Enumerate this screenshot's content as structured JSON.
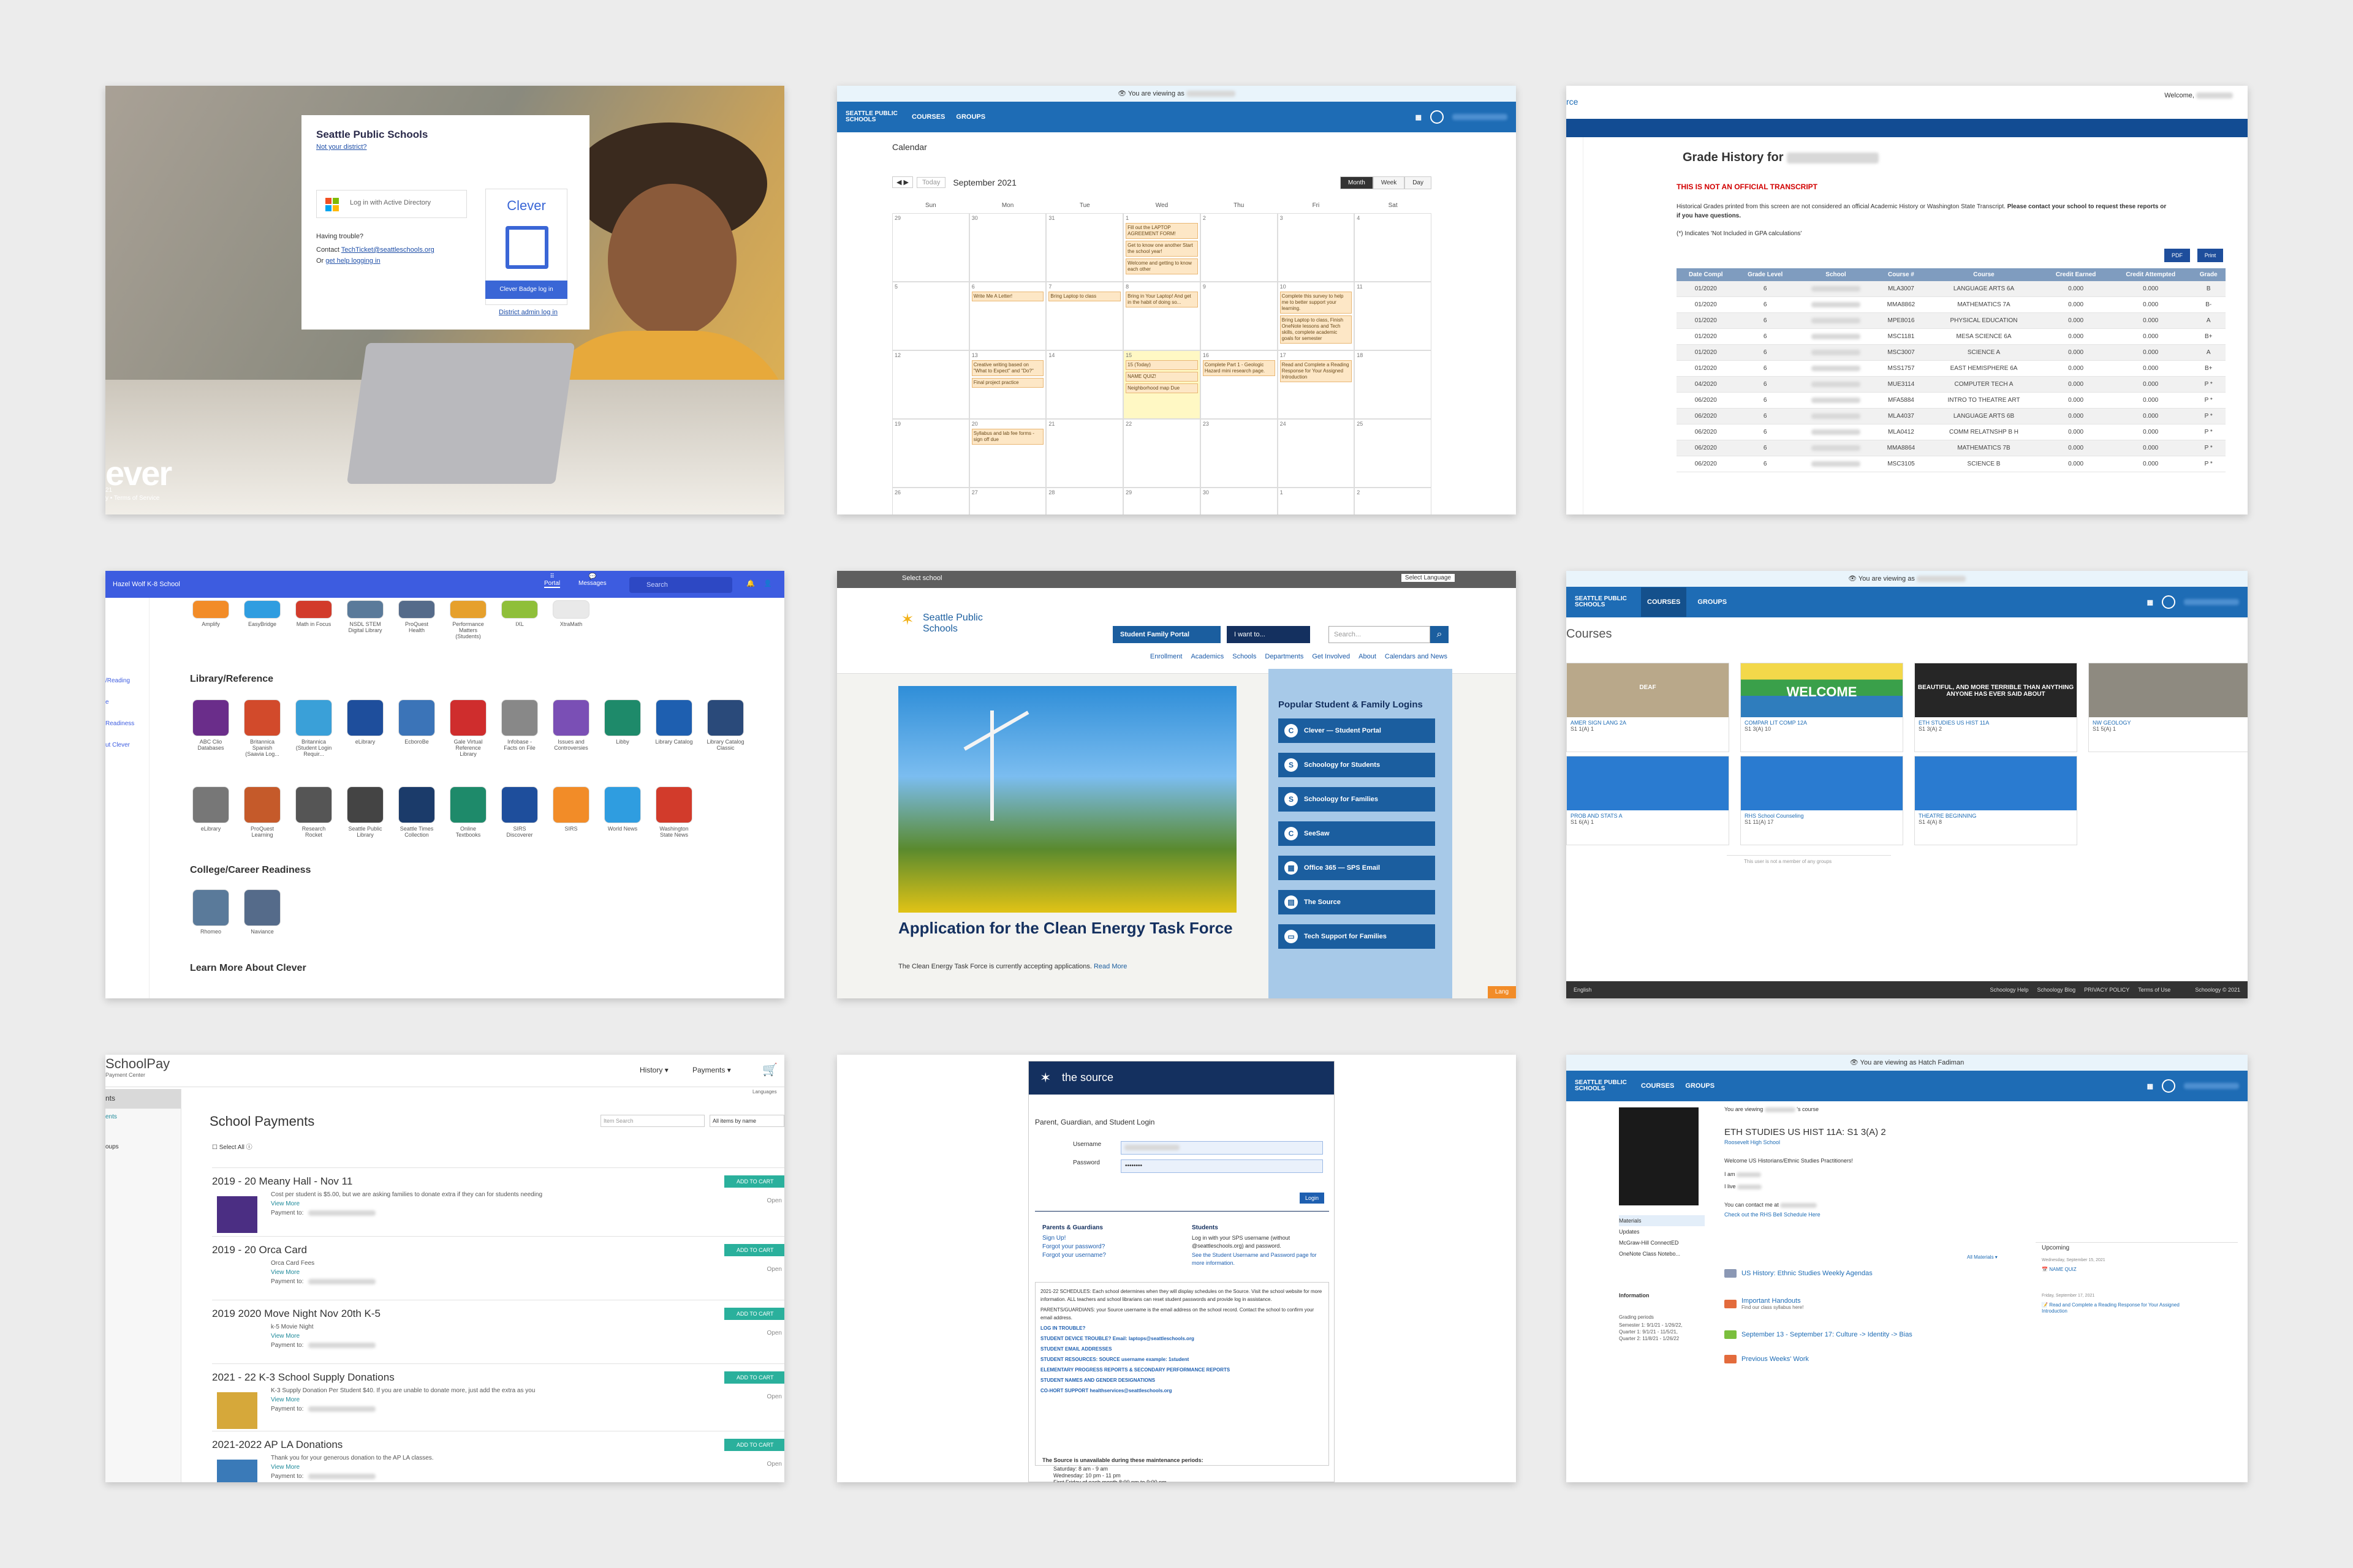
{
  "panel1": {
    "district": "Seattle Public Schools",
    "not_district": "Not your district?",
    "ad_login": "Log in with Active Directory",
    "having_trouble": "Having trouble?",
    "contact_prefix": "Contact",
    "contact_email": "TechTicket@seattleschools.org",
    "get_help_prefix": "Or",
    "get_help": "get help logging in",
    "clever_logo": "Clever",
    "badge_button": "Clever Badge log in",
    "district_admin": "District admin log in",
    "brand_text": "ever",
    "footer_year": "21",
    "footer_terms": "y • Terms of Service"
  },
  "panel2": {
    "viewing_as": "You are viewing as",
    "logo": "SEATTLE PUBLIC SCHOOLS",
    "nav": [
      "COURSES",
      "GROUPS"
    ],
    "title": "Calendar",
    "today": "Today",
    "month": "September 2021",
    "views": [
      "Month",
      "Week",
      "Day"
    ],
    "days": [
      "Sun",
      "Mon",
      "Tue",
      "Wed",
      "Thu",
      "Fri",
      "Sat"
    ],
    "weeks": [
      [
        "29",
        "30",
        "31",
        "1",
        "2",
        "3",
        "4"
      ],
      [
        "5",
        "6",
        "7",
        "8",
        "9",
        "10",
        "11"
      ],
      [
        "12",
        "13",
        "14",
        "15",
        "16",
        "17",
        "18"
      ],
      [
        "19",
        "20",
        "21",
        "22",
        "23",
        "24",
        "25"
      ],
      [
        "26",
        "27",
        "28",
        "29",
        "30",
        "1",
        "2"
      ]
    ],
    "events": {
      "e1": "Fill out the LAPTOP AGREEMENT FORM!",
      "e2": "Get to know one another Start the school year!",
      "e3": "Welcome and getting to know each other",
      "e4": "Write Me A Letter!",
      "e5": "Bring Laptop to class",
      "e6": "Bring in Your Laptop! And get in the habit of doing so...",
      "e7": "Complete this survey to help me to better support your learning.",
      "e8": "Bring Laptop to class, Finish OneNote lessons and Tech skills, complete academic goals for semester",
      "e9": "Creative writing based on \"What to Expect\" and \"Do?\"",
      "e10": "Final project practice",
      "e11": "NAME QUIZ!",
      "e12": "Neighborhood map Due",
      "e13": "Complete Part 1 - Geologic Hazard mini research page.",
      "e14": "Read and Complete a Reading Response for Your Assigned Introduction",
      "e15": "Syllabus and lab fee forms - sign off due",
      "e16": "15 (Today)"
    }
  },
  "panel3": {
    "left_text": "rce",
    "welcome": "Welcome,",
    "title": "Grade History for",
    "warning": "THIS IS NOT AN OFFICIAL TRANSCRIPT",
    "note1": "Historical Grades printed from this screen are not considered an official Academic History or Washington State Transcript.",
    "note1b": "Please contact your school to request these reports or if you have questions.",
    "note2": "(*) Indicates 'Not Included in GPA calculations'",
    "pdf": "PDF",
    "print": "Print",
    "headers": [
      "Date Compl",
      "Grade Level",
      "School",
      "Course #",
      "Course",
      "Credit Earned",
      "Credit Attempted",
      "Grade"
    ],
    "rows": [
      [
        "01/2020",
        "6",
        "",
        "MLA3007",
        "LANGUAGE ARTS 6A",
        "0.000",
        "0.000",
        "B"
      ],
      [
        "01/2020",
        "6",
        "",
        "MMA8862",
        "MATHEMATICS 7A",
        "0.000",
        "0.000",
        "B-"
      ],
      [
        "01/2020",
        "6",
        "",
        "MPE8016",
        "PHYSICAL EDUCATION",
        "0.000",
        "0.000",
        "A"
      ],
      [
        "01/2020",
        "6",
        "",
        "MSC1181",
        "MESA SCIENCE 6A",
        "0.000",
        "0.000",
        "B+"
      ],
      [
        "01/2020",
        "6",
        "",
        "MSC3007",
        "SCIENCE A",
        "0.000",
        "0.000",
        "A"
      ],
      [
        "01/2020",
        "6",
        "",
        "MSS1757",
        "EAST HEMISPHERE 6A",
        "0.000",
        "0.000",
        "B+"
      ],
      [
        "04/2020",
        "6",
        "",
        "MUE3114",
        "COMPUTER TECH A",
        "0.000",
        "0.000",
        "P *"
      ],
      [
        "06/2020",
        "6",
        "",
        "MFA5884",
        "INTRO TO THEATRE ART",
        "0.000",
        "0.000",
        "P *"
      ],
      [
        "06/2020",
        "6",
        "",
        "MLA4037",
        "LANGUAGE ARTS 6B",
        "0.000",
        "0.000",
        "P *"
      ],
      [
        "06/2020",
        "6",
        "",
        "MLA0412",
        "COMM RELATNSHP B H",
        "0.000",
        "0.000",
        "P *"
      ],
      [
        "06/2020",
        "6",
        "",
        "MMA8864",
        "MATHEMATICS 7B",
        "0.000",
        "0.000",
        "P *"
      ],
      [
        "06/2020",
        "6",
        "",
        "MSC3105",
        "SCIENCE B",
        "0.000",
        "0.000",
        "P *"
      ]
    ]
  },
  "panel4": {
    "school": "Hazel Wolf K-8 School",
    "portal": "Portal",
    "messages": "Messages",
    "search_placeholder": "Search",
    "side_links": [
      "/Reading",
      "e",
      "Readiness",
      "ut Clever"
    ],
    "row1": [
      "Amplify",
      "EasyBridge",
      "Math in Focus",
      "NSDL STEM Digital Library",
      "ProQuest Health",
      "Performance Matters (Students)",
      "IXL",
      "XtraMath"
    ],
    "section1": "Library/Reference",
    "row2": [
      "ABC Clio Databases",
      "Britannica Spanish (Saavia Log...",
      "Britannica (Student Login Requir...",
      "eLibrary",
      "EcboroBe",
      "Gale Virtual Reference Library",
      "Infobase - Facts on File",
      "Issues and Controversies",
      "Libby",
      "Library Catalog",
      "Library Catalog Classic"
    ],
    "row3": [
      "eLibrary",
      "ProQuest Learning",
      "Research Rocket",
      "Seattle Public Library",
      "Seattle Times Collection",
      "Online Textbooks",
      "SIRS Discoverer",
      "SIRS",
      "World News",
      "Washington State News"
    ],
    "section2": "College/Career Readiness",
    "row4": [
      "Rhomeo",
      "Naviance"
    ],
    "section3": "Learn More About Clever",
    "top_labels": [
      "FOCUS",
      "STEM",
      "ProQuest",
      "IXL"
    ]
  },
  "panel5": {
    "select_school": "Select school",
    "select_language": "Select Language",
    "logo": "Seattle Public Schools",
    "portal_btn": "Student Family Portal",
    "want_to": "I want to...",
    "search_placeholder": "Search...",
    "nav": [
      "Enrollment",
      "Academics",
      "Schools",
      "Departments",
      "Get Involved",
      "About",
      "Calendars and News"
    ],
    "side_title": "Popular Student & Family Logins",
    "side_buttons": [
      "Clever — Student Portal",
      "Schoology for Students",
      "Schoology for Families",
      "SeeSaw",
      "Office 365 — SPS Email",
      "The Source",
      "Tech Support for Families"
    ],
    "headline": "Application for the Clean Energy Task Force",
    "sub": "The Clean Energy Task Force is currently accepting applications.",
    "read_more": "Read More",
    "badge": "Lang"
  },
  "panel6": {
    "viewing_as": "You are viewing as",
    "logo": "SEATTLE PUBLIC SCHOOLS",
    "nav": [
      "COURSES",
      "GROUPS"
    ],
    "title": "Courses",
    "courses": [
      {
        "title": "AMER SIGN LANG 2A",
        "sec": "S1 1(A) 1",
        "img": "DEAF"
      },
      {
        "title": "COMPAR LIT COMP 12A",
        "sec": "S1 3(A) 10",
        "img": "WELCOME"
      },
      {
        "title": "ETH STUDIES US HIST 11A",
        "sec": "S1 3(A) 2",
        "img": "BEAUTIFUL, AND MORE TERRIBLE THAN ANYTHING ANYONE HAS EVER SAID ABOUT"
      },
      {
        "title": "NW GEOLOGY",
        "sec": "S1 5(A) 1",
        "img": ""
      },
      {
        "title": "PROB AND STATS A",
        "sec": "S1 6(A) 1",
        "img": ""
      },
      {
        "title": "RHS School Counseling",
        "sec": "S1 11(A) 17",
        "img": ""
      },
      {
        "title": "THEATRE BEGINNING",
        "sec": "S1 4(A) 8",
        "img": ""
      }
    ],
    "no_groups": "This user is not a member of any groups",
    "footer_left": "English",
    "footer_links": [
      "Schoology Help",
      "Schoology Blog",
      "PRIVACY POLICY",
      "Terms of Use"
    ],
    "footer_right": "Schoology © 2021"
  },
  "panel7": {
    "logo": "SchoolPay",
    "logo_sub": "Payment Center",
    "history": "History",
    "payments": "Payments",
    "side_items": [
      "nts",
      "ents",
      "oups"
    ],
    "languages": "Languages",
    "title": "School Payments",
    "item_search": "Item Search",
    "sort": "All items by name",
    "select_all": "Select All",
    "add_to_cart": "ADD TO CART",
    "open": "Open",
    "view_more": "View More",
    "payment_to": "Payment to:",
    "items": [
      {
        "title": "2019 - 20 Meany Hall - Nov 11",
        "desc": "Cost per student is $5.00, but we are asking families to donate extra if they can for students needing"
      },
      {
        "title": "2019 - 20 Orca Card",
        "desc": "Orca Card Fees"
      },
      {
        "title": "2019 2020 Move Night Nov 20th K-5",
        "desc": "k-5 Movie Night"
      },
      {
        "title": "2021 - 22 K-3 School Supply Donations",
        "desc": "K-3 Supply Donation Per Student $40.  If you are unable to donate more, just add the extra as you"
      },
      {
        "title": "2021-2022 AP LA Donations",
        "desc": "Thank you for your generous donation to the AP LA classes."
      }
    ]
  },
  "panel8": {
    "logo": "the source",
    "subtitle": "Parent, Guardian, and Student Login",
    "username": "Username",
    "password": "Password",
    "password_mask": "••••••••",
    "login": "Login",
    "pg_title": "Parents & Guardians",
    "pg_links": [
      "Sign Up!",
      "Forgot your password?",
      "Forgot your username?"
    ],
    "st_title": "Students",
    "st_text": "Log in with your SPS username (without @seattleschools.org) and password.",
    "st_link": "See the Student Username and Password page for more information.",
    "info": [
      "2021-22 SCHEDULES: Each school determines when they will display schedules on the Source. Visit the school website for more information. ALL teachers and school librarians can reset student passwords and provide log in assistance.",
      "PARENTS/GUARDIANS: your Source username is the email address on the school record. Contact the school to confirm your email address.",
      "LOG IN TROUBLE?",
      "STUDENT DEVICE TROUBLE? Email: laptops@seattleschools.org",
      "STUDENT EMAIL ADDRESSES",
      "STUDENT RESOURCES: SOURCE username example: 1student",
      "ELEMENTARY PROGRESS REPORTS & SECONDARY PERFORMANCE REPORTS",
      "STUDENT NAMES AND GENDER DESIGNATIONS",
      "CO-HORT SUPPORT healthservices@seattleschools.org"
    ],
    "maint_title": "The Source is unavailable during these maintenance periods:",
    "maint": [
      "Saturday: 8 am - 9 am",
      "Wednesday: 10 pm - 11 pm",
      "First Friday of each month 8:00 pm to 9:00 pm"
    ]
  },
  "panel9": {
    "viewing_as": "You are viewing as Hatch Fadiman",
    "logo": "SEATTLE PUBLIC SCHOOLS",
    "nav": [
      "COURSES",
      "GROUPS"
    ],
    "breadcrumb_prefix": "You are viewing",
    "breadcrumb_suffix": "'s course",
    "course_title": "ETH STUDIES US HIST 11A: S1 3(A) 2",
    "school": "Roosevelt High School",
    "subtitle": "Welcome US Historians/Ethnic Studies Practitioners!",
    "i_am": "I am",
    "i_live": "I live",
    "contact": "You can contact me at",
    "bell": "Check out the RHS Bell Schedule Here",
    "left_menu": [
      "Materials",
      "Updates",
      "McGraw-Hill ConnectED",
      "OneNote Class Notebo..."
    ],
    "info_title": "Information",
    "grading_periods": "Grading periods",
    "periods": [
      "Semester 1: 9/1/21 - 1/26/22,",
      "Quarter 1: 9/1/21 - 11/5/21,",
      "Quarter 2: 11/8/21 - 1/26/22"
    ],
    "all_materials": "All Materials",
    "folders": [
      {
        "label": "US History: Ethnic Studies Weekly Agendas",
        "color": "#8b98b4"
      },
      {
        "label": "Important Handouts",
        "sub": "Find our class syllabus here!",
        "color": "#e36b3c"
      },
      {
        "label": "September 13 - September 17: Culture -> Identity -> Bias",
        "color": "#7bbf3d"
      },
      {
        "label": "Previous Weeks' Work",
        "color": "#e36b3c"
      }
    ],
    "upcoming": "Upcoming",
    "up1_date": "Wednesday, September 15, 2021",
    "up1_item": "NAME QUIZ",
    "up2_date": "Friday, September 17, 2021",
    "up2_item": "Read and Complete a Reading Response for Your Assigned Introduction"
  }
}
